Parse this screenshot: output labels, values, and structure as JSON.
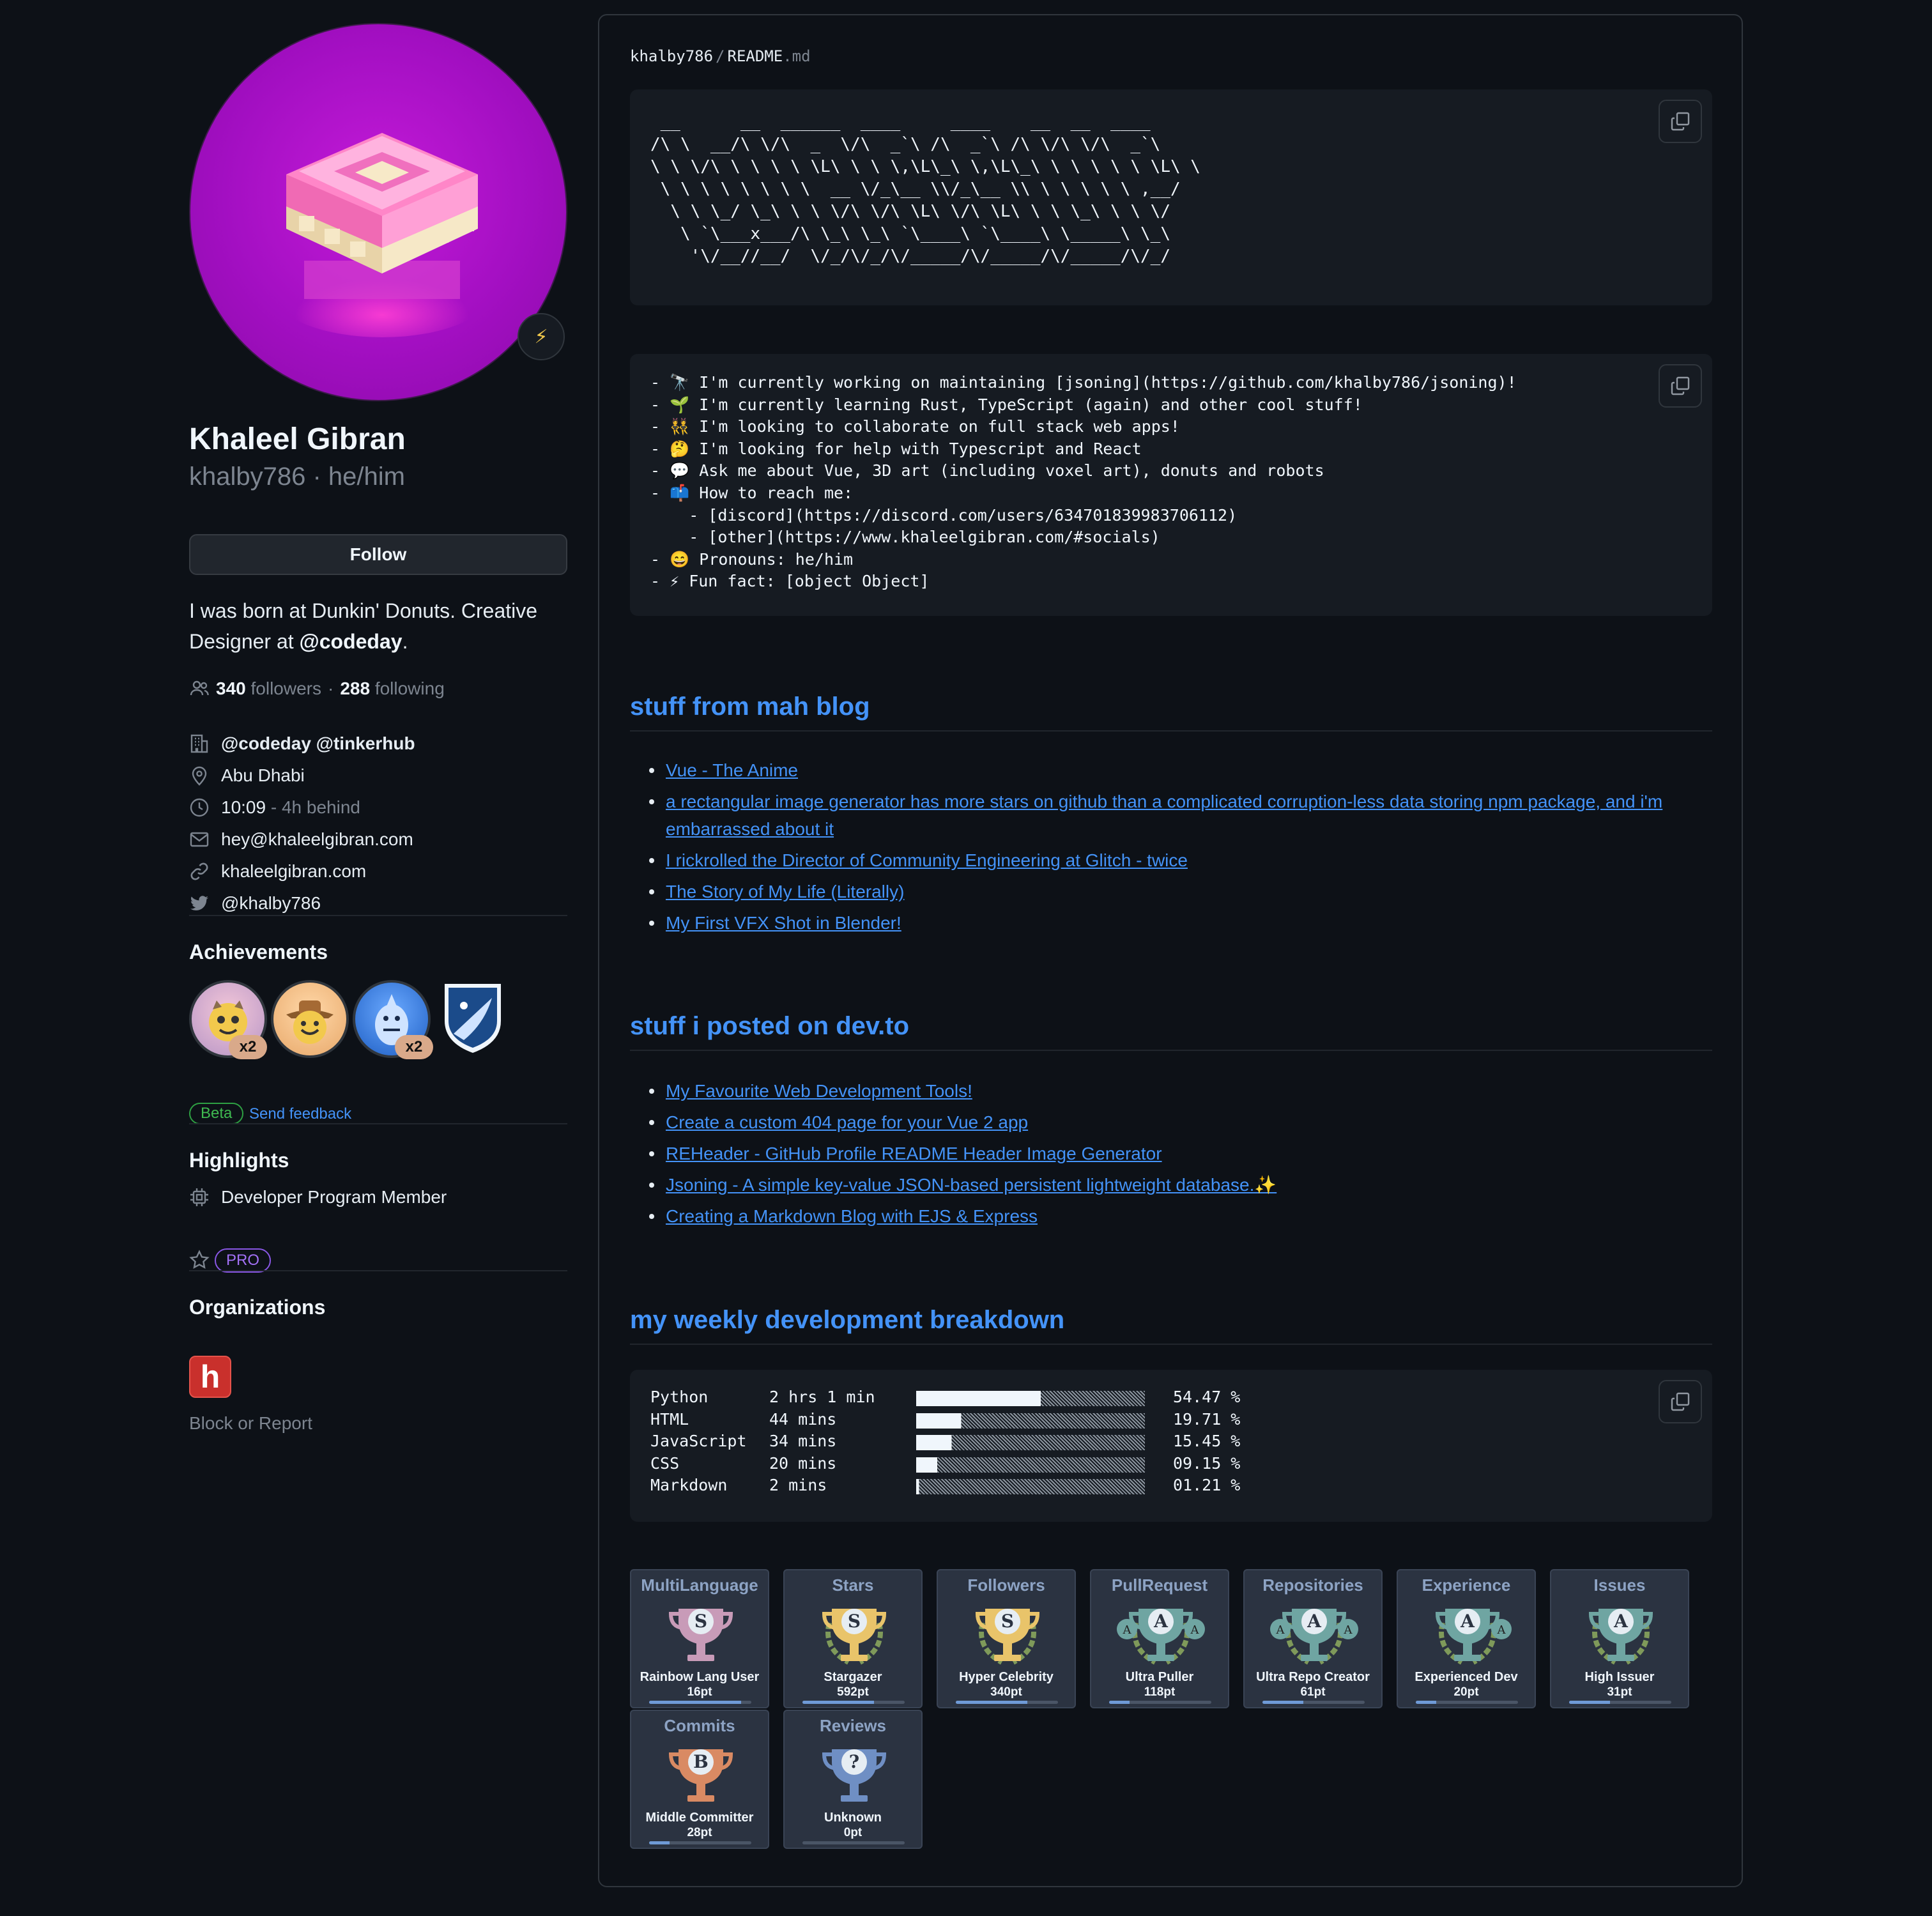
{
  "profile": {
    "full_name": "Khaleel Gibran",
    "username_line": "khalby786 · he/him",
    "status_emoji": "⚡",
    "follow_label": "Follow",
    "bio_prefix": "I was born at Dunkin' Donuts. Creative Designer at ",
    "bio_org": "@codeday",
    "bio_suffix": ".",
    "followers_count": "340",
    "followers_label": "followers",
    "following_count": "288",
    "following_label": "following",
    "separator": "·",
    "company": "@codeday @tinkerhub",
    "location": "Abu Dhabi",
    "local_time": "10:09",
    "time_offset": "- 4h behind",
    "email": "hey@khaleelgibran.com",
    "website": "khaleelgibran.com",
    "twitter": "@khalby786"
  },
  "achievements": {
    "heading": "Achievements",
    "items": [
      {
        "name": "starstruck",
        "count": "x2"
      },
      {
        "name": "yolo",
        "count": ""
      },
      {
        "name": "pull-shark",
        "count": "x2"
      },
      {
        "name": "arctic-code-vault",
        "count": ""
      }
    ],
    "beta_label": "Beta",
    "feedback_label": "Send feedback"
  },
  "highlights": {
    "heading": "Highlights",
    "developer_program": "Developer Program Member",
    "pro_label": "PRO"
  },
  "organizations": {
    "heading": "Organizations",
    "org_letter": "h",
    "block_report": "Block or Report"
  },
  "readme": {
    "path_user": "khalby786",
    "path_sep": "/",
    "path_file": "README",
    "path_ext": ".md",
    "ascii_art": " __      __  ______  ____     ____    __  __  ____\n/\\ \\  __/\\ \\/\\  _  \\/\\  _`\\ /\\  _`\\ /\\ \\/\\ \\/\\  _`\\\n\\ \\ \\/\\ \\ \\ \\ \\ \\L\\ \\ \\ \\,\\L\\_\\ \\,\\L\\_\\ \\ \\ \\ \\ \\ \\L\\ \\\n \\ \\ \\ \\ \\ \\ \\ \\  __ \\/_\\__ \\\\/_\\__ \\\\ \\ \\ \\ \\ \\ ,__/\n  \\ \\ \\_/ \\_\\ \\ \\ \\/\\ \\/\\ \\L\\ \\/\\ \\L\\ \\ \\ \\_\\ \\ \\ \\/\n   \\ `\\___x___/\\ \\_\\ \\_\\ `\\____\\ `\\____\\ \\_____\\ \\_\\\n    '\\/__//__/  \\/_/\\/_/\\/_____/\\/_____/\\/_____/\\/_/",
    "about_text": "- 🔭 I'm currently working on maintaining [jsoning](https://github.com/khalby786/jsoning)!\n- 🌱 I'm currently learning Rust, TypeScript (again) and other cool stuff!\n- 👯 I'm looking to collaborate on full stack web apps!\n- 🤔 I'm looking for help with Typescript and React\n- 💬 Ask me about Vue, 3D art (including voxel art), donuts and robots\n- 📫 How to reach me:\n    - [discord](https://discord.com/users/634701839983706112)\n    - [other](https://www.khaleelgibran.com/#socials)\n- 😄 Pronouns: he/him\n- ⚡ Fun fact: [object Object]",
    "blog_heading": "stuff from mah blog",
    "blog_links": [
      "Vue - The Anime",
      "a rectangular image generator has more stars on github than a complicated corruption-less data storing npm package, and i'm embarrassed about it",
      "I rickrolled the Director of Community Engineering at Glitch - twice",
      "The Story of My Life (Literally)",
      "My First VFX Shot in Blender!"
    ],
    "devto_heading": "stuff i posted on dev.to",
    "devto_links": [
      "My Favourite Web Development Tools!",
      "Create a custom 404 page for your Vue 2 app",
      "REHeader - GitHub Profile README Header Image Generator",
      "Jsoning - A simple key-value JSON-based persistent lightweight database.✨",
      "Creating a Markdown Blog with EJS & Express"
    ],
    "weekly_heading": "my weekly development breakdown",
    "weekly_stats": [
      {
        "lang": "Python",
        "time": "2 hrs 1 min",
        "percent_label": "54.47 %",
        "percent": 54.47
      },
      {
        "lang": "HTML",
        "time": "44 mins",
        "percent_label": "19.71 %",
        "percent": 19.71
      },
      {
        "lang": "JavaScript",
        "time": "34 mins",
        "percent_label": "15.45 %",
        "percent": 15.45
      },
      {
        "lang": "CSS",
        "time": "20 mins",
        "percent_label": "09.15 %",
        "percent": 9.15
      },
      {
        "lang": "Markdown",
        "time": "2 mins",
        "percent_label": "01.21 %",
        "percent": 1.21
      }
    ],
    "trophies": [
      {
        "title": "MultiLanguage",
        "rank": "S",
        "name": "Rainbow Lang User",
        "points": "16pt",
        "progress": 0.9,
        "color": "#c89bb8"
      },
      {
        "title": "Stars",
        "rank": "S",
        "name": "Stargazer",
        "points": "592pt",
        "progress": 0.7,
        "color": "#e9c46a"
      },
      {
        "title": "Followers",
        "rank": "S",
        "name": "Hyper Celebrity",
        "points": "340pt",
        "progress": 0.7,
        "color": "#e9c46a"
      },
      {
        "title": "PullRequest",
        "rank": "A",
        "name": "Ultra Puller",
        "points": "118pt",
        "progress": 0.2,
        "color": "#6fa5a2"
      },
      {
        "title": "Repositories",
        "rank": "A",
        "name": "Ultra Repo Creator",
        "points": "61pt",
        "progress": 0.4,
        "color": "#6fa5a2"
      },
      {
        "title": "Experience",
        "rank": "A",
        "name": "Experienced Dev",
        "points": "20pt",
        "progress": 0.2,
        "color": "#6fa5a2"
      },
      {
        "title": "Issues",
        "rank": "A",
        "name": "High Issuer",
        "points": "31pt",
        "progress": 0.4,
        "color": "#6fa5a2"
      },
      {
        "title": "Commits",
        "rank": "B",
        "name": "Middle Committer",
        "points": "28pt",
        "progress": 0.2,
        "color": "#d98a63"
      },
      {
        "title": "Reviews",
        "rank": "?",
        "name": "Unknown",
        "points": "0pt",
        "progress": 0.0,
        "color": "#6f8fc4"
      }
    ]
  }
}
